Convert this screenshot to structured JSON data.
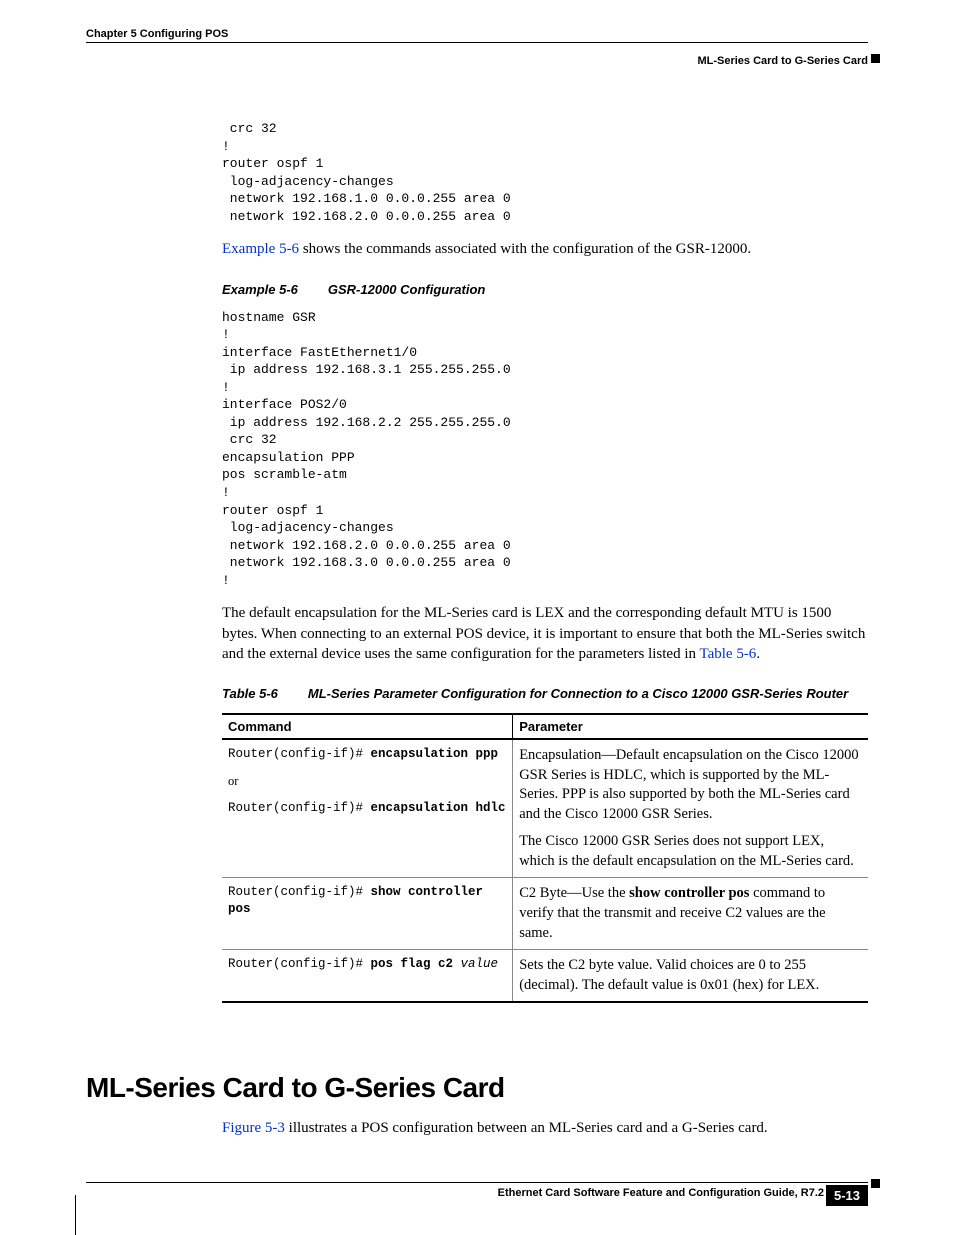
{
  "header": {
    "chapter": "Chapter 5    Configuring POS",
    "section": "ML-Series Card to G-Series Card"
  },
  "code_block_1": " crc 32\n!\nrouter ospf 1\n log-adjacency-changes\n network 192.168.1.0 0.0.0.255 area 0\n network 192.168.2.0 0.0.0.255 area 0",
  "para_1": {
    "link": "Example 5-6",
    "rest": " shows the commands associated with the configuration of the GSR-12000."
  },
  "example_caption": {
    "label": "Example 5-6",
    "text": "GSR-12000 Configuration"
  },
  "code_block_2": "hostname GSR\n!\ninterface FastEthernet1/0\n ip address 192.168.3.1 255.255.255.0\n!\ninterface POS2/0\n ip address 192.168.2.2 255.255.255.0\n crc 32\nencapsulation PPP\npos scramble-atm\n!\nrouter ospf 1\n log-adjacency-changes\n network 192.168.2.0 0.0.0.255 area 0\n network 192.168.3.0 0.0.0.255 area 0\n!",
  "para_2": {
    "text": "The default encapsulation for the ML-Series card is LEX and the corresponding default MTU is 1500 bytes. When connecting to an external POS device, it is important to ensure that both the ML-Series switch and the external device uses the same configuration for the parameters listed in ",
    "link": "Table 5-6",
    "end": "."
  },
  "table_caption": {
    "label": "Table 5-6",
    "text": "ML-Series Parameter Configuration for Connection to a Cisco 12000 GSR-Series Router"
  },
  "table": {
    "headers": [
      "Command",
      "Parameter"
    ],
    "rows": [
      {
        "command_prefix1": "Router(config-if)# ",
        "command_bold1": "encapsulation ppp",
        "command_or": "or",
        "command_prefix2": "Router(config-if)# ",
        "command_bold2": "encapsulation hdlc",
        "param1": "Encapsulation—Default encapsulation on the Cisco 12000 GSR Series is HDLC, which is supported by the ML-Series. PPP is also supported by both the ML-Series card and the Cisco 12000 GSR Series.",
        "param2": "The Cisco 12000 GSR Series does not support LEX, which is the default encapsulation on the ML-Series card."
      },
      {
        "command_prefix": "Router(config-if)# ",
        "command_bold": "show controller pos",
        "param_pre": "C2 Byte—Use the ",
        "param_bold": "show controller pos",
        "param_post": " command to verify that the transmit and receive C2 values are the same."
      },
      {
        "command_prefix": "Router(config-if)# ",
        "command_bold": "pos flag c2 ",
        "command_italic": "value",
        "param": "Sets the C2 byte value. Valid choices are 0 to 255 (decimal). The default value is 0x01 (hex) for LEX."
      }
    ]
  },
  "section_heading": "ML-Series Card to G-Series Card",
  "para_3": {
    "link": "Figure 5-3",
    "rest": " illustrates a POS configuration between an ML-Series card and a G-Series card."
  },
  "footer": {
    "guide": "Ethernet Card Software Feature and Configuration Guide, R7.2",
    "page": "5-13"
  }
}
